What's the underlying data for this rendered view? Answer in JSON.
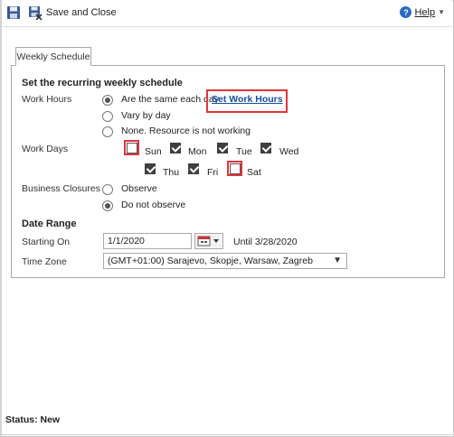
{
  "toolbar": {
    "save_close_label": "Save and Close",
    "help_label": "Help",
    "help_icon": "question-circle-icon",
    "save_icon": "floppy-disk-icon"
  },
  "tabs": [
    {
      "label": "Weekly Schedule"
    }
  ],
  "schedule": {
    "title": "Set the recurring weekly schedule",
    "work_hours": {
      "label": "Work Hours",
      "options": [
        "Are the same each day",
        "Vary by day",
        "None. Resource is not working"
      ],
      "selected": "Are the same each day",
      "link": "Set Work Hours"
    },
    "work_days": {
      "label": "Work Days",
      "days": [
        {
          "name": "Sun",
          "checked": false
        },
        {
          "name": "Mon",
          "checked": true
        },
        {
          "name": "Tue",
          "checked": true
        },
        {
          "name": "Wed",
          "checked": true
        },
        {
          "name": "Thu",
          "checked": true
        },
        {
          "name": "Fri",
          "checked": true
        },
        {
          "name": "Sat",
          "checked": false
        }
      ]
    },
    "business_closures": {
      "label": "Business Closures",
      "options": [
        "Observe",
        "Do not observe"
      ],
      "selected": "Do not observe"
    }
  },
  "date_range": {
    "title": "Date Range",
    "starting_on_label": "Starting On",
    "starting_on_value": "1/1/2020",
    "until_text": "Until 3/28/2020",
    "time_zone_label": "Time Zone",
    "time_zone_value": "(GMT+01:00) Sarajevo, Skopje, Warsaw, Zagreb"
  },
  "status": "Status: New",
  "colors": {
    "highlight": "#e0353b",
    "link": "#1a4fa0"
  }
}
